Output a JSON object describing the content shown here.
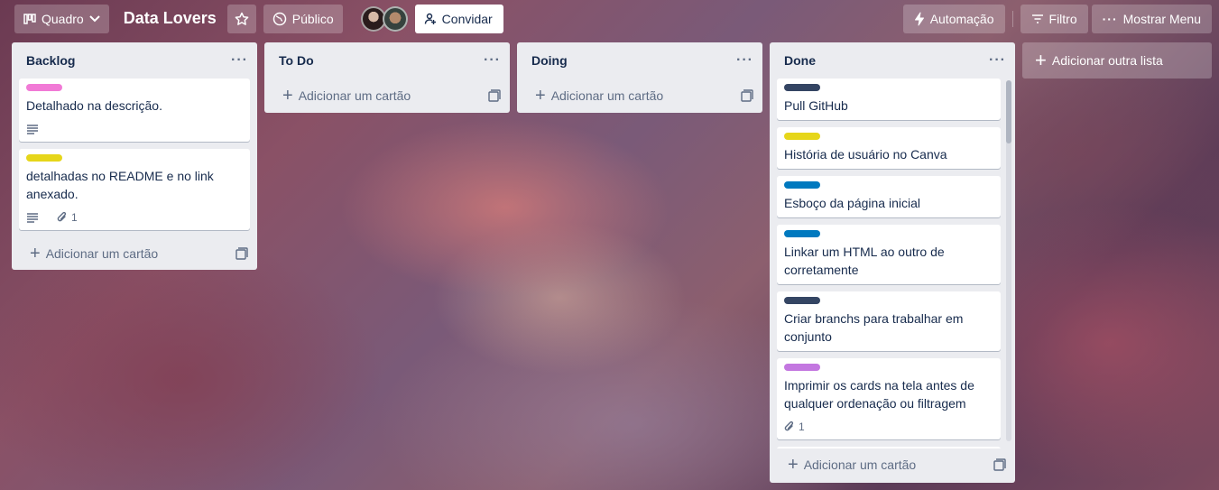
{
  "header": {
    "board_view": "Quadro",
    "board_title": "Data Lovers",
    "visibility": "Público",
    "invite": "Convidar",
    "automation": "Automação",
    "filter": "Filtro",
    "menu": "Mostrar Menu"
  },
  "lists": [
    {
      "title": "Backlog",
      "cards": [
        {
          "label_color": "#f17ad6",
          "title": "Detalhado na descrição.",
          "has_description": true
        },
        {
          "label_color": "#e6d61a",
          "title": "detalhadas no README e no link anexado.",
          "has_description": true,
          "attachments": "1"
        }
      ],
      "add_card": "Adicionar um cartão"
    },
    {
      "title": "To Do",
      "cards": [],
      "add_card": "Adicionar um cartão"
    },
    {
      "title": "Doing",
      "cards": [],
      "add_card": "Adicionar um cartão"
    },
    {
      "title": "Done",
      "cards": [
        {
          "label_color": "#344563",
          "title": "Pull GitHub"
        },
        {
          "label_color": "#e6d61a",
          "title": "História de usuário no Canva"
        },
        {
          "label_color": "#0079bf",
          "title": "Esboço da página inicial"
        },
        {
          "label_color": "#0079bf",
          "title": "Linkar um HTML ao outro de corretamente"
        },
        {
          "label_color": "#344563",
          "title": "Criar branchs para trabalhar em conjunto"
        },
        {
          "label_color": "#c377e0",
          "title": "Imprimir os cards na tela antes de qualquer ordenação ou filtragem",
          "attachments": "1"
        },
        {
          "label_color": "#0079bf",
          "title": ""
        }
      ],
      "add_card": "Adicionar um cartão"
    }
  ],
  "add_list": "Adicionar outra lista",
  "icons": {
    "board": "board-icon",
    "chevron": "chevron-down-icon",
    "star": "star-icon",
    "globe": "globe-icon",
    "invite": "add-person-icon",
    "automation": "lightning-icon",
    "filter": "filter-icon",
    "menu": "more-icon",
    "plus": "plus-icon",
    "template": "template-icon",
    "description": "description-icon",
    "attachment": "paperclip-icon"
  }
}
